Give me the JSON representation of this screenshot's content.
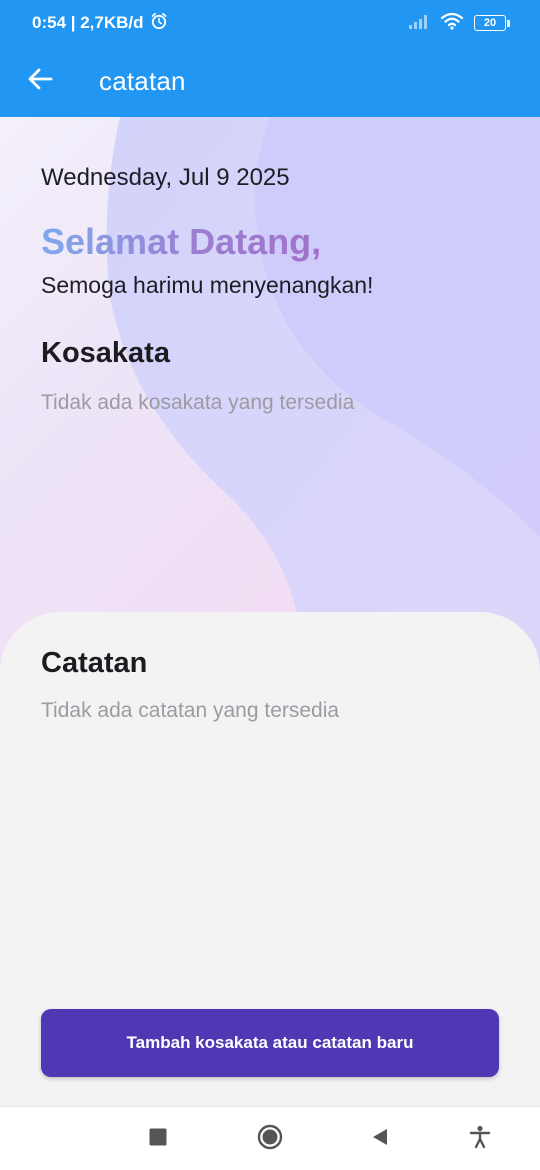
{
  "status_bar": {
    "time_speed": "0:54 | 2,7KB/d",
    "battery": "20",
    "icons": [
      "alarm-icon",
      "signal-icon",
      "wifi-icon",
      "battery-icon"
    ]
  },
  "app_bar": {
    "title": "catatan",
    "back_icon": "arrow-left-icon"
  },
  "hero": {
    "date": "Wednesday, Jul 9 2025",
    "welcome": "Selamat Datang,",
    "subtitle": "Semoga harimu menyenangkan!"
  },
  "vocab": {
    "title": "Kosakata",
    "empty": "Tidak ada kosakata yang tersedia"
  },
  "notes": {
    "title": "Catatan",
    "empty": "Tidak ada catatan yang tersedia"
  },
  "add_button": {
    "label": "Tambah kosakata atau catatan baru"
  },
  "nav_bar": {
    "icons": [
      "recents-square-icon",
      "home-circle-icon",
      "back-triangle-icon",
      "accessibility-icon"
    ]
  },
  "colors": {
    "primary": "#2196f3",
    "button": "#5038b4",
    "sheet": "#f3f3f4"
  }
}
